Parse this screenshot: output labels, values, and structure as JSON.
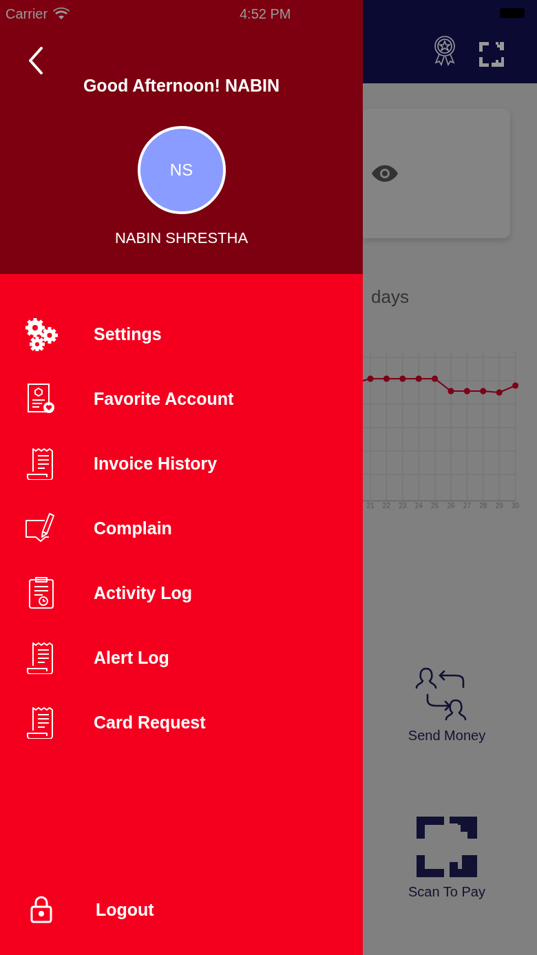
{
  "status_bar": {
    "carrier": "Carrier",
    "time": "4:52 PM"
  },
  "drawer": {
    "greeting": "Good Afternoon! NABIN",
    "avatar_initials": "NS",
    "user_name": "NABIN SHRESTHA",
    "items": [
      {
        "kind": "gears",
        "label": "Settings"
      },
      {
        "kind": "favorite",
        "label": "Favorite Account"
      },
      {
        "kind": "receipt",
        "label": "Invoice History"
      },
      {
        "kind": "complain",
        "label": "Complain"
      },
      {
        "kind": "clipboard",
        "label": "Activity Log"
      },
      {
        "kind": "receipt",
        "label": "Alert Log"
      },
      {
        "kind": "receipt",
        "label": "Card Request"
      }
    ],
    "logout": {
      "kind": "lock",
      "label": "Logout"
    }
  },
  "background": {
    "period_label": "days",
    "chart": {
      "x_labels": [
        "21",
        "22",
        "23",
        "24",
        "25",
        "26",
        "27",
        "28",
        "29",
        "30"
      ]
    },
    "actions": [
      {
        "kind": "transfer",
        "label": "Send Money"
      },
      {
        "kind": "qr",
        "label": "Scan To Pay"
      }
    ]
  }
}
